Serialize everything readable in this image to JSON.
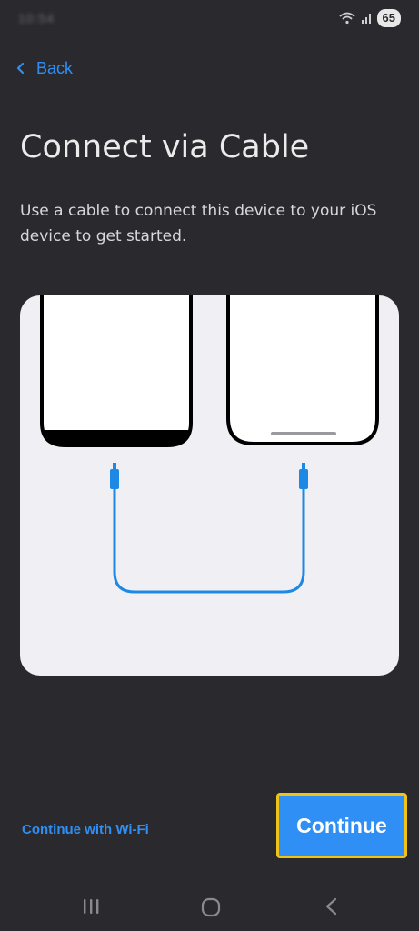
{
  "status_bar": {
    "time": "10:54",
    "battery": "65",
    "icons": [
      "wifi-icon",
      "signal-icon"
    ]
  },
  "header": {
    "back_label": "Back"
  },
  "main": {
    "title": "Connect via Cable",
    "description": "Use a cable to connect this device to your iOS device to get started."
  },
  "illustration": {
    "cable_color": "#1e88e5",
    "card_color": "#f0f0f4",
    "devices": [
      "android-phone",
      "ios-phone"
    ]
  },
  "footer": {
    "wifi_link_label": "Continue with Wi-Fi",
    "continue_label": "Continue"
  },
  "nav_bar": {
    "items": [
      "recents-icon",
      "home-icon",
      "back-icon"
    ]
  },
  "colors": {
    "background": "#2a2a2e",
    "accent": "#2f8ff5",
    "highlight_border": "#f2c316"
  }
}
